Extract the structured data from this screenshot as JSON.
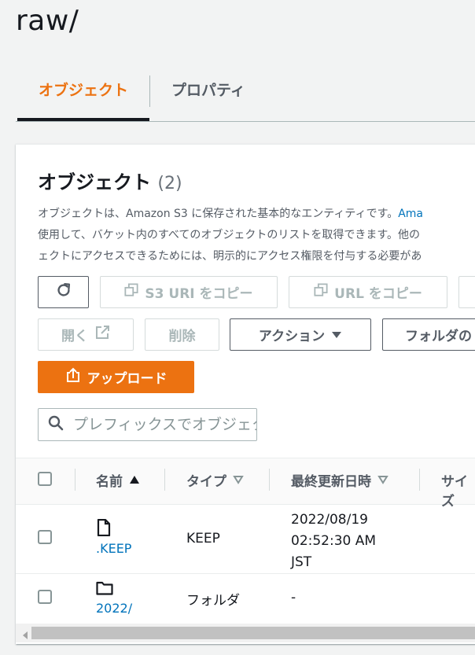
{
  "page": {
    "title": "raw/"
  },
  "tabs": [
    {
      "label": "オブジェクト",
      "active": true
    },
    {
      "label": "プロパティ",
      "active": false
    }
  ],
  "objects_panel": {
    "title": "オブジェクト",
    "count": "(2)",
    "description_line1": "オブジェクトは、Amazon S3 に保存された基本的なエンティティです。",
    "description_link": "Ama",
    "description_line2": "使用して、バケット内のすべてのオブジェクトのリストを取得できます。他の",
    "description_line3": "ェクトにアクセスできるためには、明示的にアクセス権限を付与する必要があ"
  },
  "toolbar": {
    "copy_s3_uri": "S3 URI をコピー",
    "copy_url": "URL をコピー",
    "open": "開く",
    "delete": "削除",
    "actions": "アクション",
    "create_folder": "フォルダの",
    "upload": "アップロード"
  },
  "search": {
    "placeholder": "プレフィックスでオブジェクトを検索",
    "value": ""
  },
  "table": {
    "columns": [
      "名前",
      "タイプ",
      "最終更新日時",
      "サイズ"
    ],
    "rows": [
      {
        "name": ".KEEP",
        "type": "KEEP",
        "modified_line1": "2022/08/19",
        "modified_line2": "02:52:30 AM",
        "modified_line3": "JST",
        "icon": "file-icon"
      },
      {
        "name": "2022/",
        "type": "フォルダ",
        "modified_line1": "-",
        "icon": "folder-icon"
      }
    ]
  },
  "colors": {
    "accent": "#ec7211",
    "link": "#0073bb",
    "text": "#16191f"
  }
}
